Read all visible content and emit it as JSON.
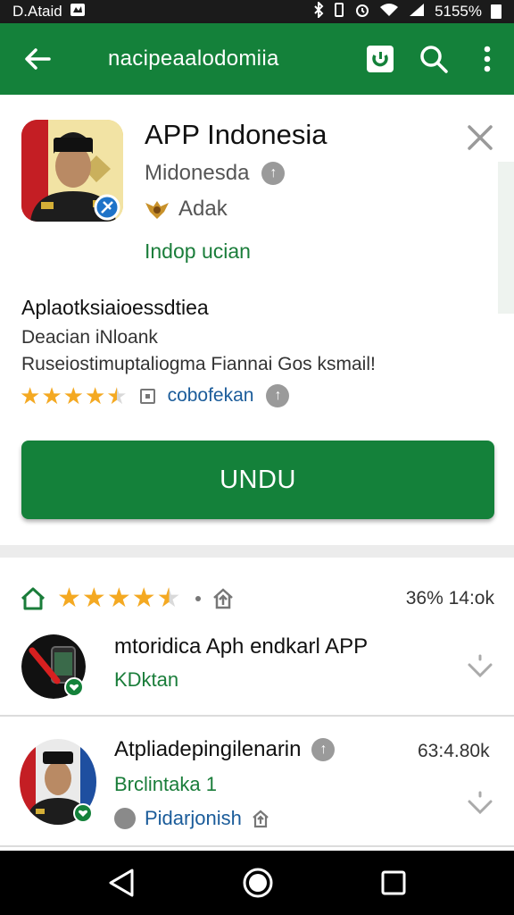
{
  "status_bar": {
    "left_text": "D.Ataid",
    "right_text": "5155%"
  },
  "app_bar": {
    "title": "nacipeaalodomiia",
    "back_icon": "arrow-left-icon",
    "actions": [
      "play-store-icon",
      "search-icon",
      "more-vert-icon"
    ]
  },
  "app": {
    "name": "APP Indonesia",
    "developer": "Midonesda",
    "publisher": "Adak",
    "category_link": "Indop ucian",
    "description_title": "Aplaotksiaioessdtiea",
    "description_lines": [
      "Deacian iNloank",
      "Ruseiostimuptaliogma Fiannai Gos ksmail!"
    ],
    "rating_value": 4.5,
    "rating_link": "cobofekan",
    "install_label": "UNDU"
  },
  "reviews": {
    "rating_value": 4.5,
    "summary_pct": "36% 14:ok"
  },
  "list": [
    {
      "title": "mtoridica Aph endkarl APP",
      "subtitle": "KDktan",
      "extra": ""
    },
    {
      "title": "Atpliadepingilenarin",
      "subtitle": "Brclintaka 1",
      "extra": "Pidarjonish",
      "pct": "63:4.80k"
    }
  ],
  "colors": {
    "brand_green": "#14813a",
    "star": "#f4a922",
    "link_blue": "#1b5c9a"
  }
}
